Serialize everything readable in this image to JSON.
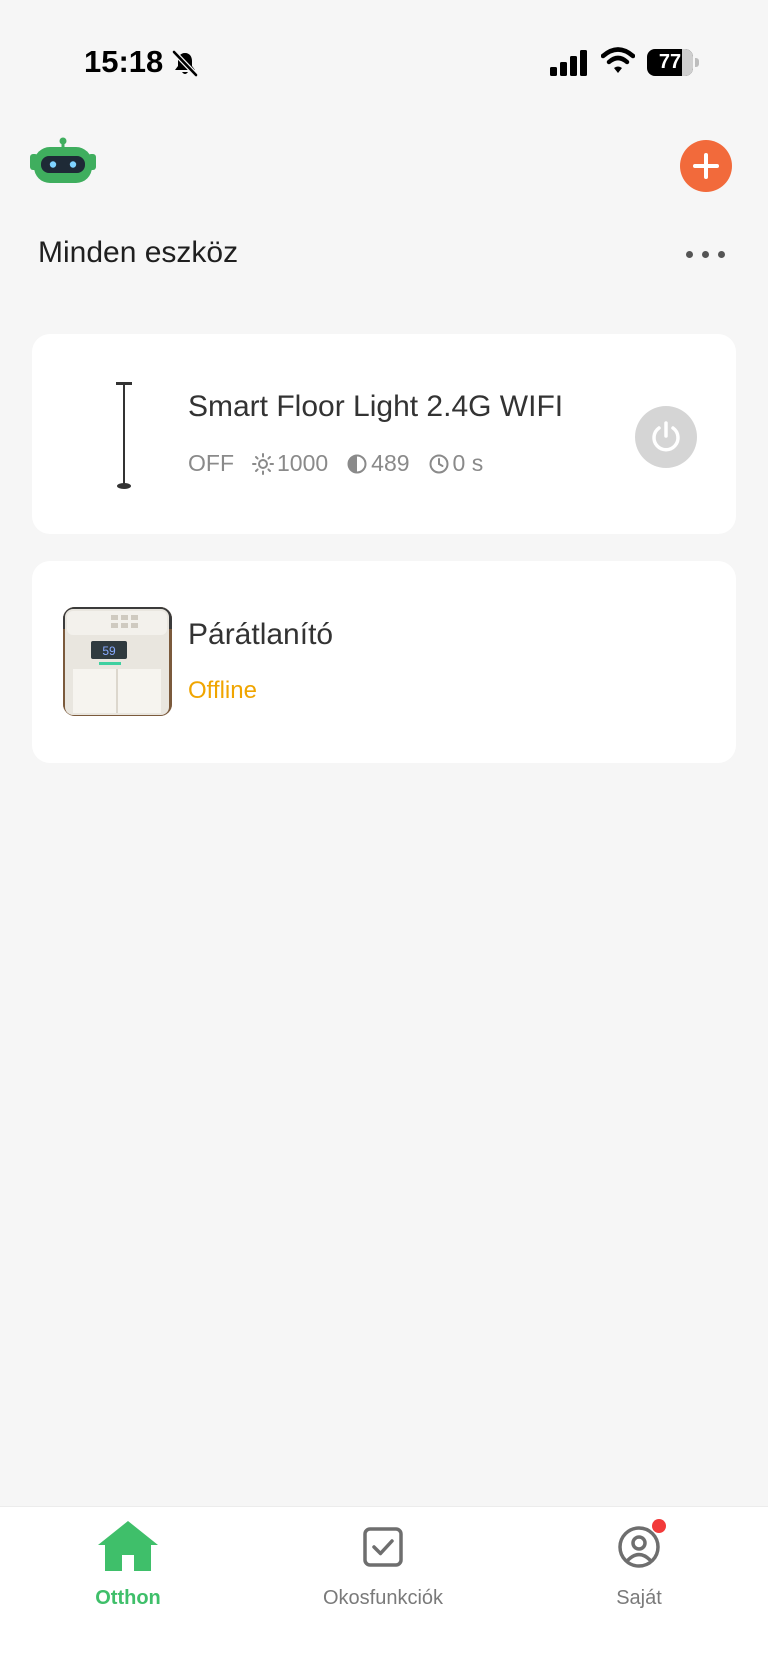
{
  "status_bar": {
    "time": "15:18",
    "battery": "77",
    "battery_level": 0.77,
    "bell_icon": "bell-slash-icon",
    "signal_icon": "cellular-signal-icon",
    "wifi_icon": "wifi-icon"
  },
  "header": {
    "avatar_icon": "robot-icon",
    "add_icon": "plus-icon",
    "title": "Minden eszköz",
    "more_icon": "ellipsis-icon"
  },
  "devices": [
    {
      "name": "Smart Floor Light 2.4G WIFI",
      "image_icon": "floor-lamp-icon",
      "state": "OFF",
      "brightness": "1000",
      "color_temp": "489",
      "timer": "0 s",
      "power_icon": "power-icon"
    },
    {
      "name": "Párátlanító",
      "image_icon": "dehumidifier-photo",
      "status": "Offline"
    }
  ],
  "tab_bar": {
    "tabs": [
      {
        "label": "Otthon",
        "icon": "home-icon",
        "active": true
      },
      {
        "label": "Okosfunkciók",
        "icon": "checkbox-icon",
        "active": false
      },
      {
        "label": "Saját",
        "icon": "user-circle-icon",
        "active": false,
        "badge": true
      }
    ]
  },
  "colors": {
    "accent_orange": "#f26a3b",
    "active_green": "#3fbf6a",
    "offline_yellow": "#f0a500",
    "badge_red": "#f23a3a",
    "background": "#f6f6f6"
  }
}
